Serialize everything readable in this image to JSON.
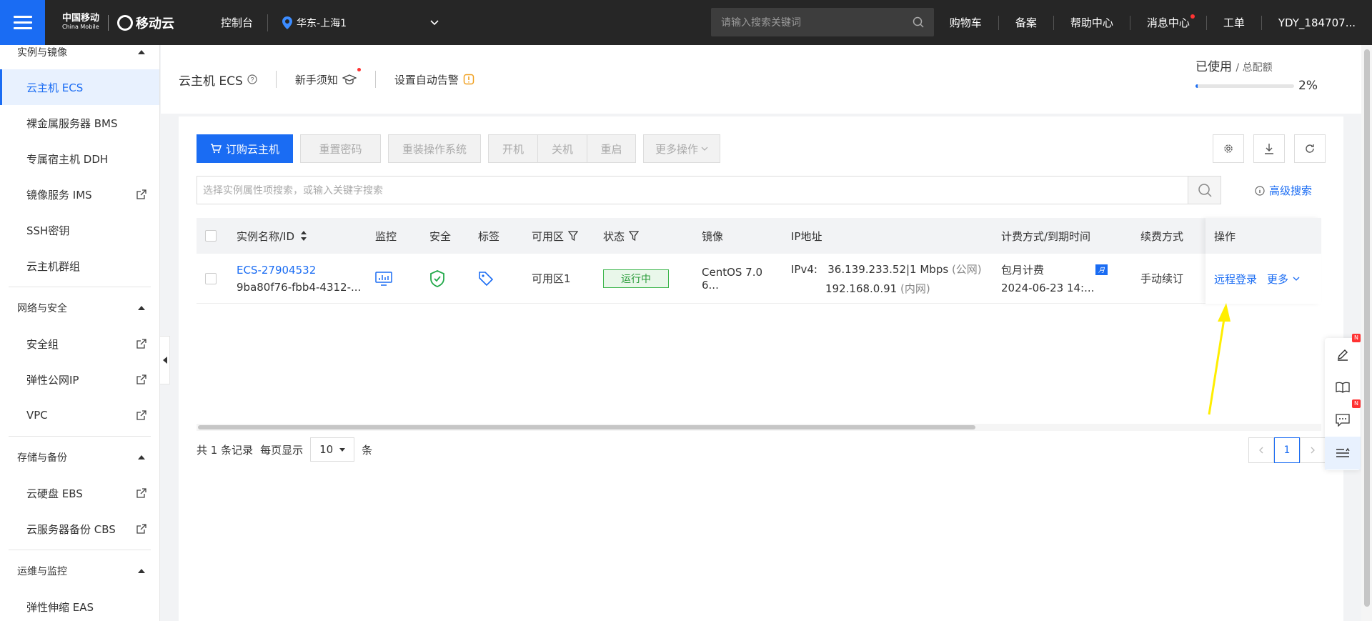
{
  "topbar": {
    "logo_cm": "中国移动",
    "logo_cm_en": "China Mobile",
    "logo_yd": "移动云",
    "console": "控制台",
    "region": "华东-上海1",
    "search_placeholder": "请输入搜索关键词",
    "nav": [
      "购物车",
      "备案",
      "帮助中心",
      "消息中心",
      "工单",
      "YDY_184707..."
    ]
  },
  "sidebar": {
    "groups": [
      {
        "label": "实例与镜像",
        "items": [
          {
            "label": "云主机 ECS",
            "ext": false,
            "active": true
          },
          {
            "label": "裸金属服务器 BMS",
            "ext": false
          },
          {
            "label": "专属宿主机 DDH",
            "ext": false
          },
          {
            "label": "镜像服务 IMS",
            "ext": true
          },
          {
            "label": "SSH密钥",
            "ext": false
          },
          {
            "label": "云主机群组",
            "ext": false
          }
        ]
      },
      {
        "label": "网络与安全",
        "items": [
          {
            "label": "安全组",
            "ext": true
          },
          {
            "label": "弹性公网IP",
            "ext": true
          },
          {
            "label": "VPC",
            "ext": true
          }
        ]
      },
      {
        "label": "存储与备份",
        "items": [
          {
            "label": "云硬盘 EBS",
            "ext": true
          },
          {
            "label": "云服务器备份 CBS",
            "ext": true
          }
        ]
      },
      {
        "label": "运维与监控",
        "items": [
          {
            "label": "弹性伸缩 EAS",
            "ext": false
          }
        ]
      }
    ]
  },
  "header": {
    "title": "云主机 ECS",
    "guide": "新手须知",
    "alert": "设置自动告警",
    "quota_used": "已使用",
    "quota_total": "/ 总配额",
    "quota_pct": "2%",
    "quota_fraction": 0.02
  },
  "toolbar": {
    "buy": "订购云主机",
    "reset_pwd": "重置密码",
    "reinstall": "重装操作系统",
    "start": "开机",
    "stop": "关机",
    "restart": "重启",
    "more_ops": "更多操作"
  },
  "search": {
    "placeholder": "选择实例属性项搜索，或输入关键字搜索",
    "advanced": "高级搜索"
  },
  "table": {
    "headers": [
      "实例名称/ID",
      "监控",
      "安全",
      "标签",
      "可用区",
      "状态",
      "镜像",
      "IP地址",
      "计费方式/到期时间",
      "续费方式",
      "操作"
    ],
    "row": {
      "name": "ECS-27904532",
      "id": "9ba80f76-fbb4-4312-...",
      "zone": "可用区1",
      "status": "运行中",
      "image": "CentOS 7.0 6...",
      "ipv4_label": "IPv4:",
      "ip_public": "36.139.233.52|1 Mbps",
      "ip_public_tag": "(公网)",
      "ip_private": "192.168.0.91",
      "ip_private_tag": "(内网)",
      "billing": "包月计费",
      "billing_badge": "月",
      "expire": "2024-06-23 14:...",
      "renew": "手动续订",
      "op_login": "远程登录",
      "op_more": "更多"
    }
  },
  "pagination": {
    "total": "共 1 条记录",
    "per_page_label": "每页显示",
    "per_page": "10",
    "unit": "条",
    "current": "1"
  },
  "colors": {
    "accent": "#1a6cf3",
    "topbar": "#262626",
    "running": "#2a9c3a",
    "annotation_arrow": "#ffee00"
  }
}
